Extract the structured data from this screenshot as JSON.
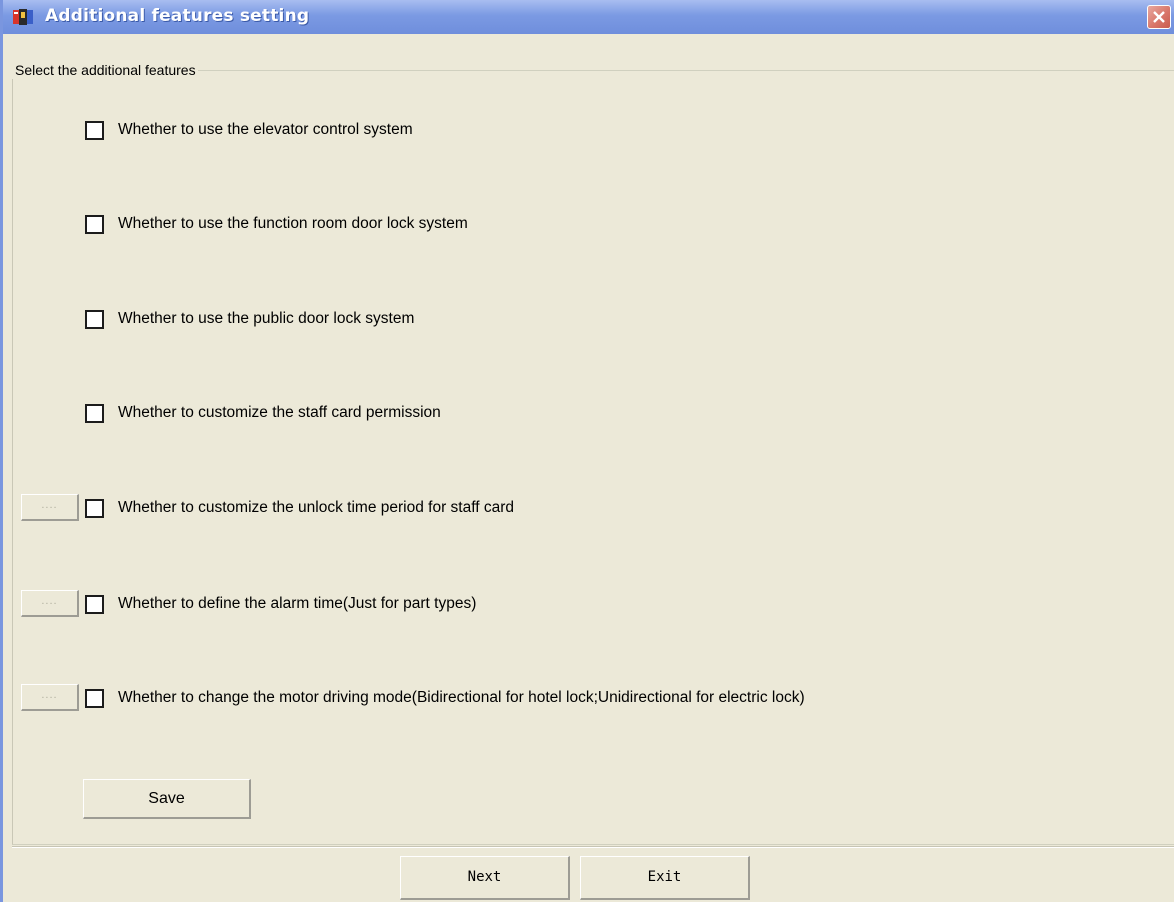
{
  "window": {
    "title": "Additional features setting"
  },
  "group": {
    "legend": "Select the additional features"
  },
  "features": [
    {
      "label": "Whether to use the elevator control system",
      "checked": false
    },
    {
      "label": "Whether to use the function room door lock system",
      "checked": false
    },
    {
      "label": "Whether to use the public door lock system",
      "checked": false
    },
    {
      "label": "Whether to customize the staff card permission",
      "checked": false
    },
    {
      "label": "Whether to customize the unlock time period for staff card",
      "checked": false
    },
    {
      "label": "Whether to define the alarm time(Just for part types)",
      "checked": false
    },
    {
      "label": "Whether to change the motor driving mode(Bidirectional for hotel lock;Unidirectional for electric lock)",
      "checked": false
    }
  ],
  "buttons": {
    "dots": "....",
    "save": "Save",
    "next": "Next",
    "exit": "Exit"
  }
}
